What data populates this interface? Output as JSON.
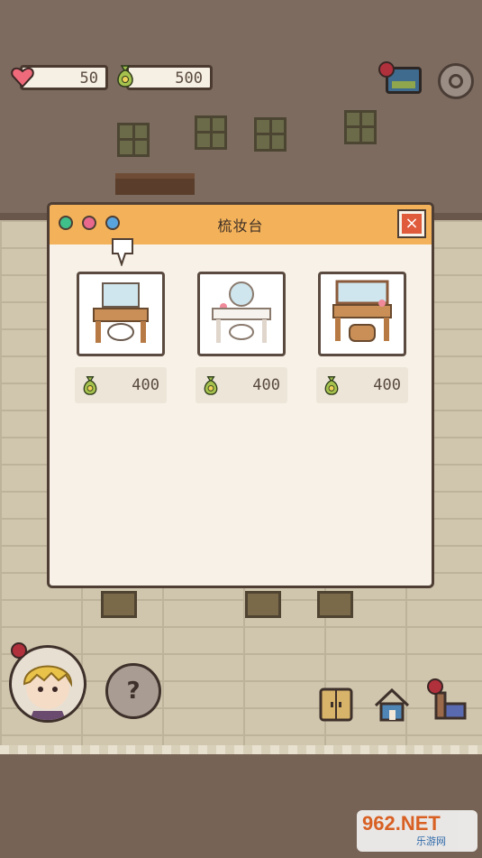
{
  "hud": {
    "hearts": "50",
    "coins": "500"
  },
  "panel": {
    "title": "梳妆台",
    "close_label": "×",
    "items": [
      {
        "price": "400"
      },
      {
        "price": "400"
      },
      {
        "price": "400"
      }
    ]
  },
  "bottom": {
    "help_label": "?"
  },
  "watermark": {
    "logo": "962.NET",
    "sub": "乐游网"
  },
  "colors": {
    "panel_header": "#f3b25a",
    "close_button": "#e05b3c",
    "dot_green": "#3fbf8a",
    "dot_pink": "#e9688e",
    "dot_blue": "#5aa4dd"
  }
}
